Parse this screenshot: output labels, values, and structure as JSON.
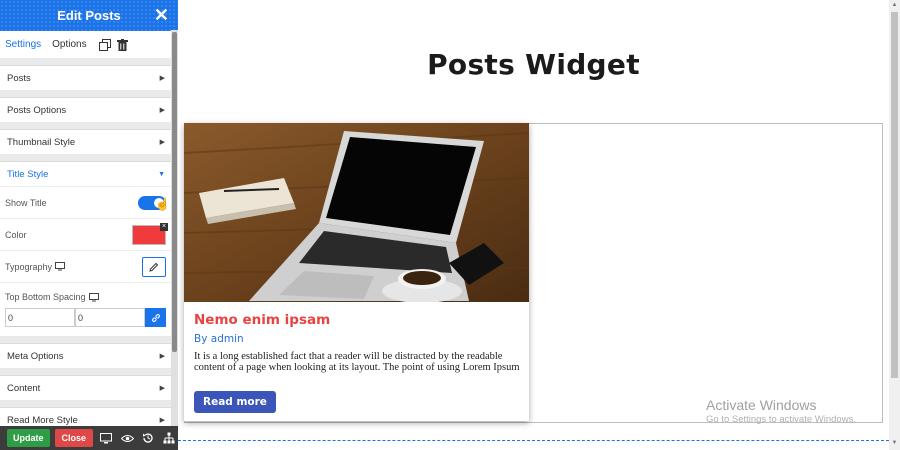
{
  "panel": {
    "title": "Edit Posts",
    "close_glyph": "✕",
    "tabs": {
      "settings": "Settings",
      "options": "Options"
    },
    "sections_top": [
      {
        "label": "Posts"
      },
      {
        "label": "Posts Options"
      },
      {
        "label": "Thumbnail Style"
      }
    ],
    "open_section": {
      "label": "Title Style",
      "show_title_label": "Show Title",
      "show_title_enabled": true,
      "color_label": "Color",
      "color_value": "#ef3b3b",
      "typography_label": "Typography",
      "spacing_label": "Top Bottom Spacing",
      "spacing_top_value": "0",
      "spacing_bottom_value": "0"
    },
    "sections_bottom": [
      {
        "label": "Meta Options"
      },
      {
        "label": "Content"
      },
      {
        "label": "Read More Style"
      }
    ],
    "footer": {
      "update_label": "Update",
      "close_label": "Close"
    }
  },
  "canvas": {
    "heading": "Posts Widget",
    "post": {
      "title": "Nemo enim ipsam",
      "author": "By admin",
      "excerpt": "It is a long established fact that a reader will be distracted by the readable content of a page when looking at its layout. The point of using Lorem Ipsum",
      "read_more": "Read more",
      "image_icon": "laptop-on-desk-photo"
    }
  },
  "watermark": {
    "title": "Activate Windows",
    "subtitle": "Go to Settings to activate Windows."
  },
  "colors": {
    "accent": "#1a73e8",
    "post_title": "#e84343",
    "read_more_bg": "#3b55b8",
    "update_bg": "#2e9d46",
    "close_bg": "#e04747"
  }
}
